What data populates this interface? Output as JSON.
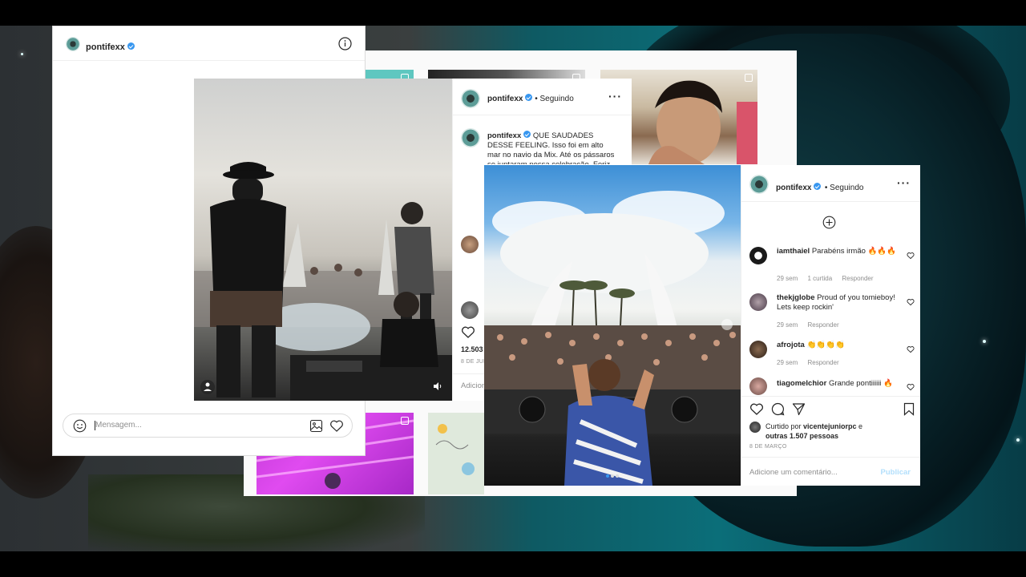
{
  "dm": {
    "username": "pontifexx",
    "message_placeholder": "Mensagem..."
  },
  "post_middle": {
    "username": "pontifexx",
    "follow_state": "• Seguindo",
    "caption_username": "pontifexx",
    "caption_text": "QUE SAUDADES DESSE FEELING. Isso foi em alto mar no navio da Mix. Até os pássaros se juntaram nessa celebração. Feriz de",
    "likes_partial": "12.503",
    "date_partial": "8 DE JUN",
    "add_comment_partial": "Adicion"
  },
  "post_front": {
    "username": "pontifexx",
    "follow_state": "• Seguindo",
    "comments": [
      {
        "user": "iamthaiel",
        "text": "Parabéns irmão 🔥🔥🔥",
        "time": "29 sem",
        "likes": "1 curtida",
        "reply": "Responder"
      },
      {
        "user": "thekjglobe",
        "text": "Proud of you tomieboy! Lets keep rockin'",
        "time": "29 sem",
        "reply": "Responder"
      },
      {
        "user": "afrojota",
        "text": "👏👏👏👏",
        "time": "29 sem",
        "reply": "Responder"
      },
      {
        "user": "tiagomelchior",
        "text": "Grande pontiiiiii 🔥"
      }
    ],
    "liked_by_prefix": "Curtido por ",
    "liked_by_user": "vicentejuniorpc",
    "liked_by_conj": " e",
    "liked_by_others": "outras 1.507 pessoas",
    "date": "8 DE MARÇO",
    "add_comment_placeholder": "Adicione um comentário...",
    "publish_label": "Publicar"
  },
  "colors": {
    "accent_blue": "#3897f0",
    "publish_disabled": "#b2dffc",
    "text_muted": "#8e8e8e"
  }
}
